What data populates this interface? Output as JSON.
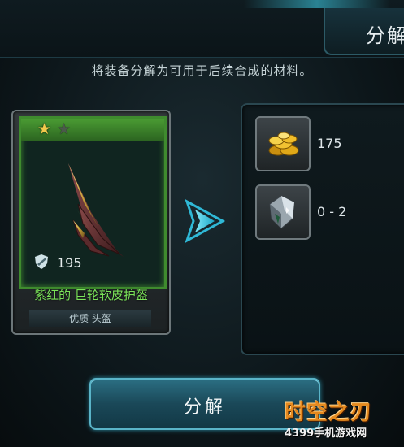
{
  "header": {
    "title": "分解"
  },
  "description": "将装备分解为可用于后续合成的材料。",
  "item": {
    "stars_filled": 1,
    "stars_total": 2,
    "armor_value": "195",
    "name": "紫红的 巨轮软皮护盔",
    "quality_type": "优质 头盔",
    "colors": {
      "frame": "#3f8b2e",
      "name": "#7be35a"
    }
  },
  "results": [
    {
      "icon": "gold-coins-icon",
      "amount": "175"
    },
    {
      "icon": "crystal-shard-icon",
      "amount": "0 - 2"
    }
  ],
  "actions": {
    "decompose_label": "分解"
  },
  "watermark": {
    "logo_text": "时空之刃",
    "site_text": "4399手机游戏网"
  }
}
